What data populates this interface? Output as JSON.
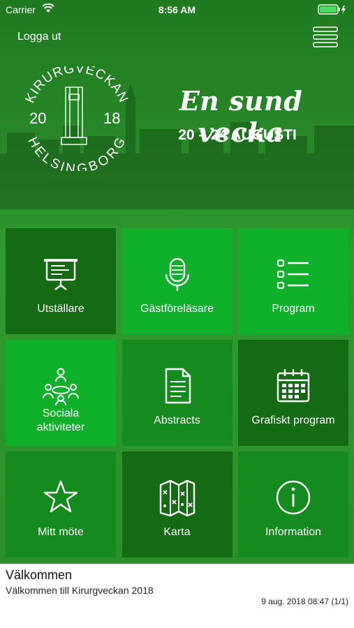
{
  "status_bar": {
    "carrier": "Carrier",
    "time": "8:56 AM"
  },
  "header": {
    "logout_label": "Logga ut",
    "menu_icon": "hamburger-menu-icon"
  },
  "banner": {
    "logo_top": "KIRURGVECKAN",
    "logo_year_left": "20",
    "logo_year_right": "18",
    "logo_bottom": "HELSINGBORG",
    "tagline": "En sund vecka",
    "dates": "20 – 24 AUGUSTI"
  },
  "tiles": [
    {
      "label": "Utställare",
      "icon": "presentation-board-icon",
      "color": "#146b14"
    },
    {
      "label": "Gästföreläsare",
      "icon": "microphone-icon",
      "color": "#0fb02a"
    },
    {
      "label": "Program",
      "icon": "list-icon",
      "color": "#0fb02a"
    },
    {
      "label": "Sociala aktiviteter",
      "icon": "meeting-group-icon",
      "color": "#0fb02a"
    },
    {
      "label": "Abstracts",
      "icon": "document-icon",
      "color": "#148a1f"
    },
    {
      "label": "Grafiskt program",
      "icon": "calendar-icon",
      "color": "#146b14"
    },
    {
      "label": "Mitt möte",
      "icon": "star-icon",
      "color": "#148a1f"
    },
    {
      "label": "Karta",
      "icon": "map-icon",
      "color": "#146b14"
    },
    {
      "label": "Information",
      "icon": "info-icon",
      "color": "#148a1f"
    }
  ],
  "news": {
    "title": "Välkommen",
    "body": "Välkommen till Kirurgveckan 2018",
    "meta": "9 aug. 2018 08:47 (1/1)"
  }
}
